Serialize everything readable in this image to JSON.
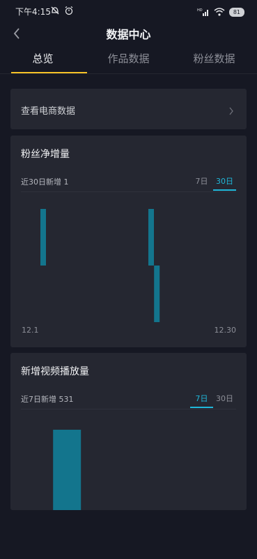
{
  "status_bar": {
    "time": "下午4:15",
    "network_label": "HD",
    "battery": "81"
  },
  "nav": {
    "title": "数据中心"
  },
  "tabs": [
    {
      "label": "总览",
      "active": true
    },
    {
      "label": "作品数据",
      "active": false
    },
    {
      "label": "粉丝数据",
      "active": false
    }
  ],
  "ecommerce": {
    "label": "查看电商数据"
  },
  "fans_card": {
    "title": "粉丝净增量",
    "summary": "近30日新增 1",
    "ranges": [
      {
        "label": "7日",
        "active": false
      },
      {
        "label": "30日",
        "active": true
      }
    ],
    "x_start_label": "12.1",
    "x_end_label": "12.30"
  },
  "plays_card": {
    "title": "新增视频播放量",
    "summary": "近7日新增 531",
    "ranges": [
      {
        "label": "7日",
        "active": true
      },
      {
        "label": "30日",
        "active": false
      }
    ]
  },
  "colors": {
    "background": "#161823",
    "card": "#252731",
    "accent_tab": "#f6c327",
    "accent_range": "#20b7d9",
    "bar": "#13758d"
  },
  "chart_data": [
    {
      "type": "bar",
      "title": "粉丝净增量",
      "x_range": [
        "12.1",
        "12.30"
      ],
      "ylim": [
        -1,
        1
      ],
      "x": [
        1,
        20,
        21
      ],
      "values": [
        1,
        1,
        -1
      ]
    },
    {
      "type": "bar",
      "title": "新增视频播放量",
      "x": [
        2
      ],
      "values": [
        531
      ],
      "ylim": [
        0,
        531
      ]
    }
  ]
}
